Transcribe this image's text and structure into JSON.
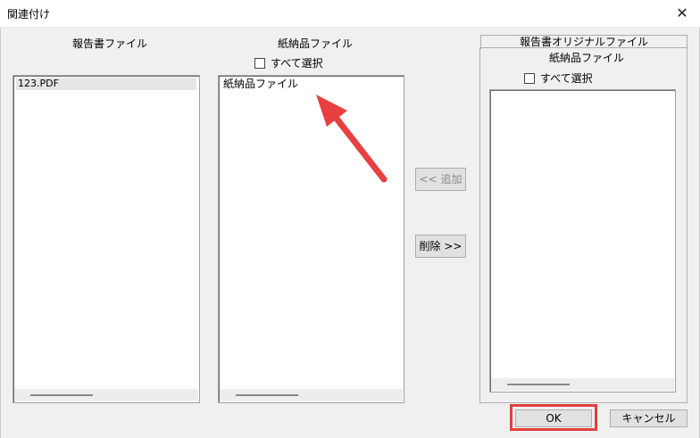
{
  "window": {
    "title": "関連付け",
    "close_glyph": "✕"
  },
  "report": {
    "header": "報告書ファイル",
    "items": [
      "123.PDF"
    ]
  },
  "paper": {
    "header": "紙納品ファイル",
    "select_all": "すべて選択",
    "items": [
      "紙納品ファイル"
    ]
  },
  "original": {
    "tab": "報告書オリジナルファイル",
    "header": "紙納品ファイル",
    "select_all": "すべて選択"
  },
  "buttons": {
    "add": "<< 追加",
    "delete": "削除 >>",
    "ok": "OK",
    "cancel": "キャンセル"
  },
  "colors": {
    "highlight": "#e23f3f",
    "arrow": "#e84040"
  }
}
